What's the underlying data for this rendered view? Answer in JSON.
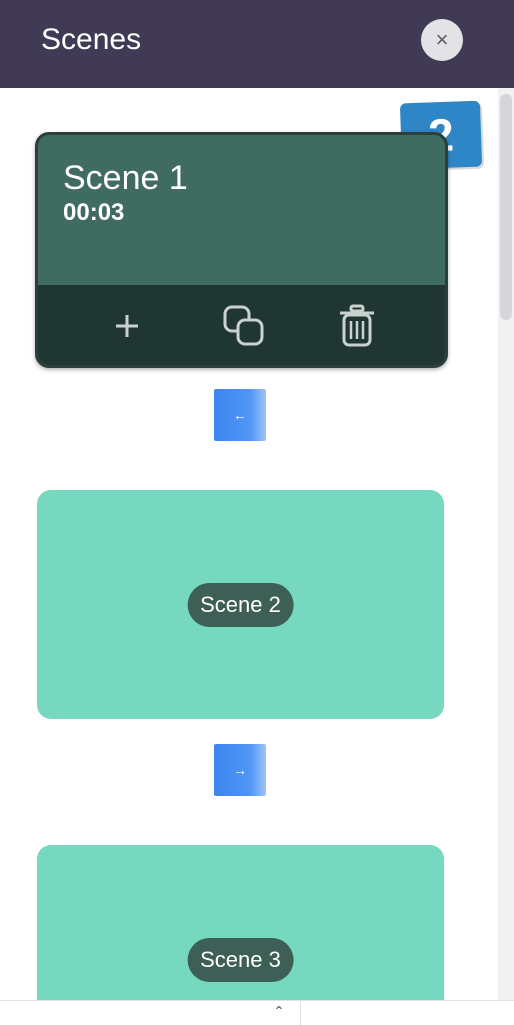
{
  "header": {
    "title": "Scenes",
    "close_glyph": "×"
  },
  "badge": {
    "label": "2"
  },
  "active_scene": {
    "name": "Scene 1",
    "duration": "00:03",
    "tools": [
      {
        "icon": "plus-icon"
      },
      {
        "icon": "duplicate-icon"
      },
      {
        "icon": "trash-icon"
      }
    ]
  },
  "transitions": [
    {
      "glyph": "←"
    },
    {
      "glyph": "→"
    }
  ],
  "scenes": [
    {
      "label": "Scene 2"
    },
    {
      "label": "Scene 3"
    }
  ],
  "colors": {
    "header_bg": "#403a55",
    "active_scene_bg": "#3f6b60",
    "active_toolbar_bg": "#1f3632",
    "scene_card_bg": "#76d8bf",
    "scene_pill_bg": "#3d5f56",
    "transition_bg": "#4f96f5",
    "badge_bg": "#2f86c6"
  }
}
